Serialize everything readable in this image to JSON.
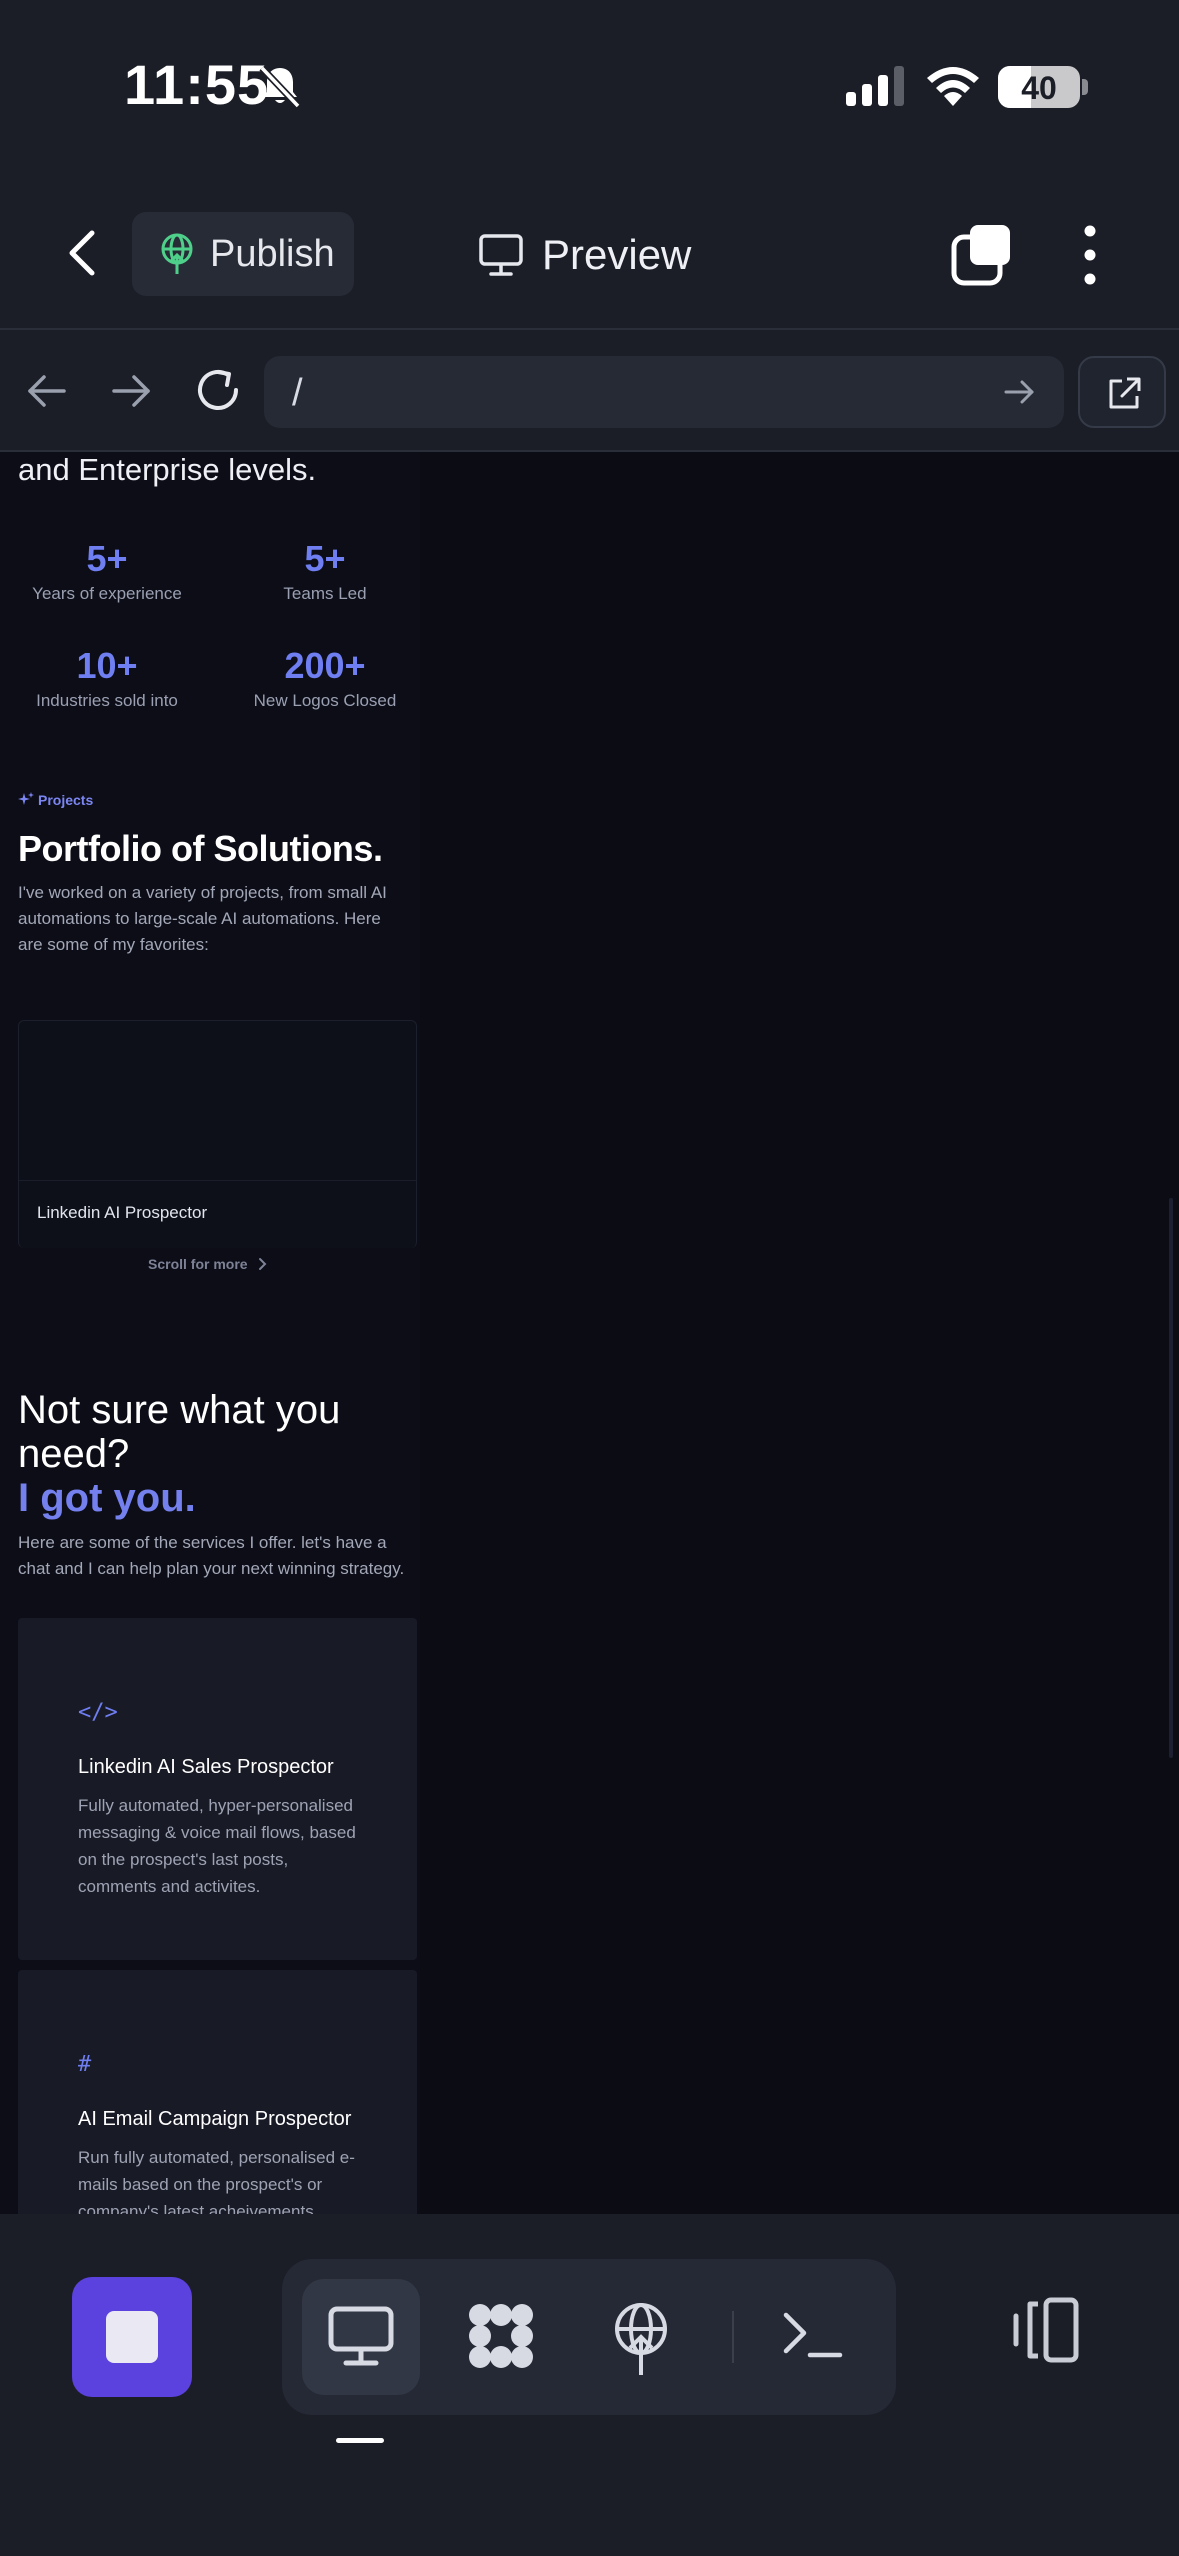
{
  "status_bar": {
    "time": "11:55",
    "battery": "40",
    "battery_level": 0.4
  },
  "header": {
    "publish_label": "Publish",
    "preview_label": "Preview"
  },
  "browser": {
    "url": "/"
  },
  "site": {
    "intro_tail": "and Enterprise levels.",
    "stats": [
      {
        "value": "5+",
        "label": "Years of experience"
      },
      {
        "value": "5+",
        "label": "Teams Led"
      },
      {
        "value": "10+",
        "label": "Industries sold into"
      },
      {
        "value": "200+",
        "label": "New Logos Closed"
      }
    ],
    "projects": {
      "tag": "Projects",
      "title": "Portfolio of Solutions.",
      "description": "I've worked on a variety of projects, from small AI automations to large-scale AI automations. Here are some of my favorites:",
      "items": [
        {
          "title": "Linkedin AI Prospector"
        }
      ],
      "scroll_more": "Scroll for more"
    },
    "services": {
      "title": "Not sure what you need?",
      "accent": "I got you.",
      "description": "Here are some of the services I offer. let's have a chat and I can help plan your next winning strategy.",
      "items": [
        {
          "icon": "</>",
          "title": "Linkedin AI Sales Prospector",
          "description": "Fully automated, hyper-personalised messaging & voice mail flows, based on the prospect's last posts, comments and activites."
        },
        {
          "icon": "#",
          "title": "AI Email Campaign Prospector",
          "description": "Run fully automated, personalised e-mails based on the prospect's or company's latest acheivements."
        }
      ]
    }
  },
  "colors": {
    "accent": "#6f7ef0",
    "stop_button": "#5b41dd",
    "publish_icon": "#4fd08a"
  },
  "toolbar": {
    "icons": [
      "stop-icon",
      "desktop-preview-icon",
      "workflow-icon",
      "deploy-icon",
      "terminal-icon",
      "panels-icon"
    ]
  }
}
